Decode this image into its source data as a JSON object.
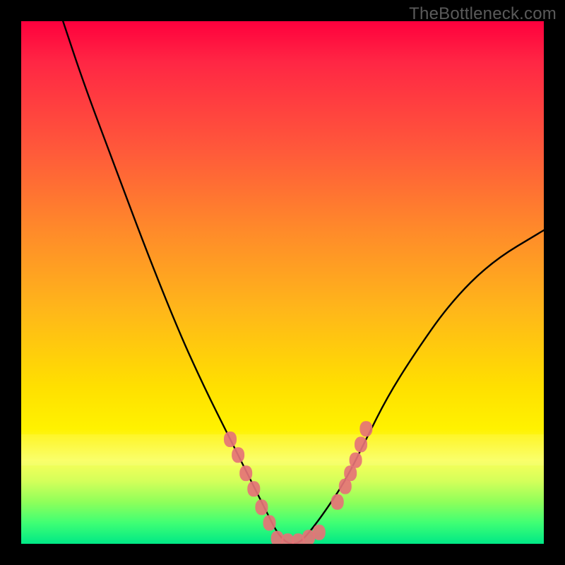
{
  "watermark": "TheBottleneck.com",
  "chart_data": {
    "type": "line",
    "title": "",
    "xlabel": "",
    "ylabel": "",
    "xlim": [
      0,
      100
    ],
    "ylim": [
      0,
      100
    ],
    "grid": false,
    "legend": null,
    "series": [
      {
        "name": "curve",
        "color": "#000000",
        "x": [
          8,
          12,
          18,
          24,
          30,
          35,
          40,
          44,
          47,
          49,
          51,
          53,
          55,
          58,
          62,
          66,
          70,
          75,
          82,
          90,
          100
        ],
        "values": [
          100,
          88,
          72,
          56,
          41,
          30,
          20,
          12,
          6,
          2,
          0,
          0,
          2,
          6,
          12,
          20,
          28,
          36,
          46,
          54,
          60
        ]
      }
    ],
    "markers": {
      "color": "#e57377",
      "shape": "rounded-rect",
      "points_left": [
        [
          40,
          20
        ],
        [
          41.5,
          17
        ],
        [
          43,
          13.5
        ],
        [
          44.5,
          10.5
        ],
        [
          46,
          7
        ],
        [
          47.5,
          4
        ]
      ],
      "points_floor": [
        [
          49,
          1
        ],
        [
          51,
          0.5
        ],
        [
          53,
          0.5
        ],
        [
          55,
          1.2
        ],
        [
          57,
          2.2
        ]
      ],
      "points_right": [
        [
          60.5,
          8
        ],
        [
          62,
          11
        ],
        [
          63,
          13.5
        ],
        [
          64,
          16
        ],
        [
          65,
          19
        ],
        [
          66,
          22
        ]
      ]
    },
    "background_gradient": {
      "direction": "vertical",
      "stops": [
        {
          "pos": 0,
          "color": "#ff003d"
        },
        {
          "pos": 25,
          "color": "#ff5a3a"
        },
        {
          "pos": 55,
          "color": "#ffb61a"
        },
        {
          "pos": 78,
          "color": "#fff200"
        },
        {
          "pos": 92,
          "color": "#8fff5a"
        },
        {
          "pos": 100,
          "color": "#00e886"
        }
      ]
    }
  }
}
